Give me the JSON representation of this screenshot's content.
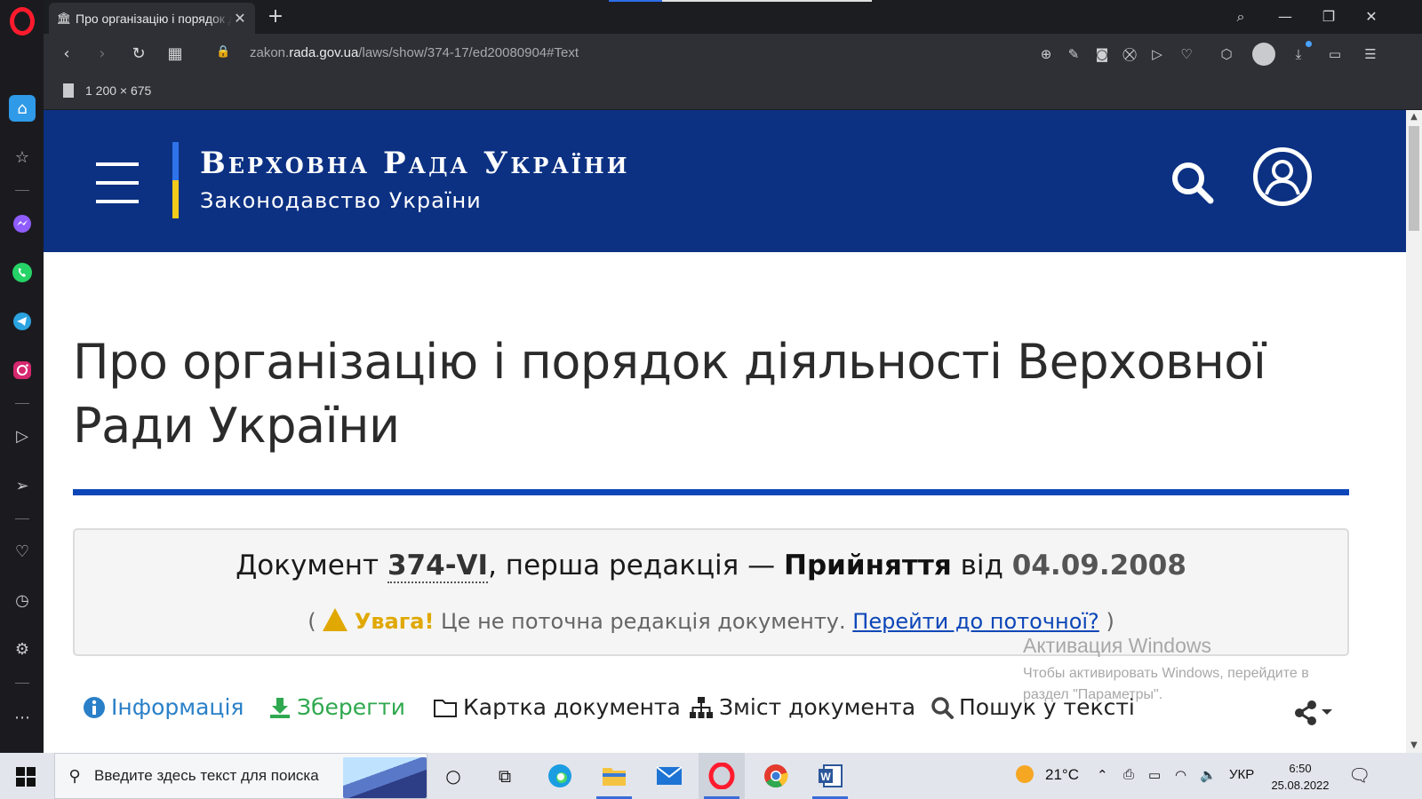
{
  "browser": {
    "tab_title": "Про організацію і порядок діяльності Верховної Ради України",
    "url_prefix": "zakon.",
    "url_domain": "rada.gov.ua",
    "url_path": "/laws/show/374-17/ed20080904#Text",
    "image_dims": "1 200 × 675"
  },
  "header": {
    "brand_title": "Верховна Рада України",
    "brand_subtitle": "Законодавство України"
  },
  "document": {
    "title": "Про організацію і порядок діяльності Верховної Ради України",
    "label": "Документ",
    "number": "374-VI",
    "edition": ", перша редакція — ",
    "action": "Прийняття",
    "from": " від ",
    "date": "04.09.2008",
    "paren_open": "(",
    "paren_close": ")",
    "warning_label": "Увага!",
    "warning_text": " Це не поточна редакція документу. ",
    "warning_link": "Перейти до поточної?"
  },
  "doc_tabs": {
    "info": "Інформація",
    "save": "Зберегти",
    "card": "Картка документа",
    "contents": "Зміст документа",
    "search": "Пошук у тексті"
  },
  "activation": {
    "title": "Активация Windows",
    "line": "Чтобы активировать Windows, перейдите в раздел \"Параметры\"."
  },
  "taskbar": {
    "search_placeholder": "Введите здесь текст для поиска",
    "weather": "21°C",
    "language": "УКР",
    "time": "6:50",
    "date": "25.08.2022"
  },
  "colors": {
    "header_blue": "#0c3183",
    "flag_blue": "#2f73ea",
    "flag_yellow": "#f3cb1b",
    "warning": "#e0a800",
    "link": "#0c46b8"
  }
}
